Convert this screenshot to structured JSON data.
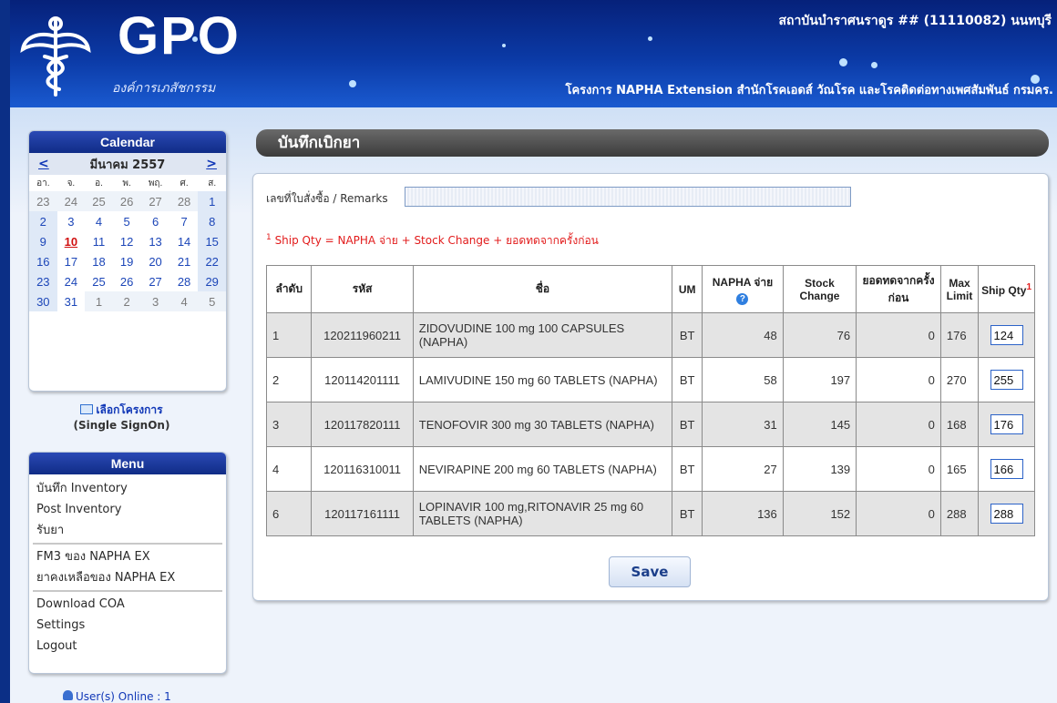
{
  "header": {
    "logo_text": "GPO",
    "logo_sub": "องค์การเภสัชกรรม",
    "hospital": "สถาบันบำราศนราดูร ## (11110082) นนทบุรี",
    "project": "โครงการ NAPHA Extension สำนักโรคเอดส์ วัณโรค และโรคติดต่อทางเพศสัมพันธ์ กรมคร."
  },
  "calendar": {
    "title": "Calendar",
    "prev": "<",
    "next": ">",
    "month": "มีนาคม 2557",
    "dow": [
      "อา.",
      "จ.",
      "อ.",
      "พ.",
      "พฤ.",
      "ศ.",
      "ส."
    ],
    "weeks": [
      [
        "23",
        "24",
        "25",
        "26",
        "27",
        "28",
        "1"
      ],
      [
        "2",
        "3",
        "4",
        "5",
        "6",
        "7",
        "8"
      ],
      [
        "9",
        "10",
        "11",
        "12",
        "13",
        "14",
        "15"
      ],
      [
        "16",
        "17",
        "18",
        "19",
        "20",
        "21",
        "22"
      ],
      [
        "23",
        "24",
        "25",
        "26",
        "27",
        "28",
        "29"
      ],
      [
        "30",
        "31",
        "1",
        "2",
        "3",
        "4",
        "5"
      ]
    ]
  },
  "sso": {
    "label": "เลือกโครงการ",
    "sub": "(Single SignOn)"
  },
  "menu": {
    "title": "Menu",
    "items": [
      "บันทึก Inventory",
      "Post Inventory",
      "รับยา",
      "FM3 ของ NAPHA EX",
      "ยาคงเหลือของ NAPHA EX",
      "Download COA",
      "Settings",
      "Logout"
    ]
  },
  "online": "User(s) Online : 1",
  "page": {
    "title": "บันทึกเบิกยา",
    "remarks_label": "เลขที่ใบสั่งซื้อ / Remarks",
    "remarks_value": "",
    "note": "Ship Qty = NAPHA จ่าย + Stock Change + ยอดทดจากครั้งก่อน",
    "note_sup": "1",
    "save": "Save"
  },
  "table": {
    "headers": {
      "seq": "ลำดับ",
      "code": "รหัส",
      "name": "ชื่อ",
      "um": "UM",
      "napha": "NAPHA จ่าย",
      "stock": "Stock Change",
      "carry": "ยอดทดจากครั้งก่อน",
      "max": "Max Limit",
      "ship": "Ship Qty",
      "ship_sup": "1"
    },
    "rows": [
      {
        "seq": "1",
        "code": "120211960211",
        "name": "ZIDOVUDINE 100 mg 100 CAPSULES (NAPHA)",
        "um": "BT",
        "napha": "48",
        "stock": "76",
        "carry": "0",
        "max": "176",
        "ship": "124"
      },
      {
        "seq": "2",
        "code": "120114201111",
        "name": "LAMIVUDINE 150 mg 60 TABLETS (NAPHA)",
        "um": "BT",
        "napha": "58",
        "stock": "197",
        "carry": "0",
        "max": "270",
        "ship": "255"
      },
      {
        "seq": "3",
        "code": "120117820111",
        "name": "TENOFOVIR 300 mg 30 TABLETS (NAPHA)",
        "um": "BT",
        "napha": "31",
        "stock": "145",
        "carry": "0",
        "max": "168",
        "ship": "176"
      },
      {
        "seq": "4",
        "code": "120116310011",
        "name": "NEVIRAPINE 200 mg 60 TABLETS (NAPHA)",
        "um": "BT",
        "napha": "27",
        "stock": "139",
        "carry": "0",
        "max": "165",
        "ship": "166"
      },
      {
        "seq": "6",
        "code": "120117161111",
        "name": "LOPINAVIR 100 mg,RITONAVIR 25 mg 60 TABLETS (NAPHA)",
        "um": "BT",
        "napha": "136",
        "stock": "152",
        "carry": "0",
        "max": "288",
        "ship": "288"
      }
    ]
  }
}
